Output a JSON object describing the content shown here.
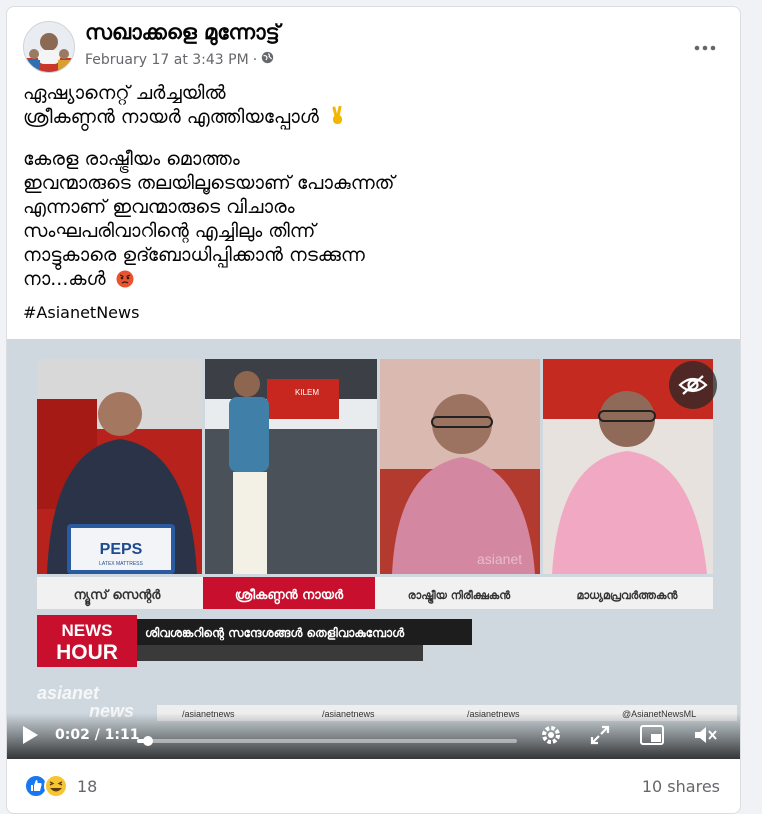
{
  "post": {
    "page_name": "സഖാക്കളെ മുന്നോട്ട്",
    "timestamp": "February 17 at 3:43 PM",
    "separator": "·",
    "body_p1": [
      "ഏഷ്യാനെറ്റ് ചർച്ചയിൽ",
      "ശ്രീകണ്ഠൻ നായർ എത്തിയപ്പോൾ"
    ],
    "body_p2": [
      "കേരള രാഷ്ട്രീയം മൊത്തം",
      "ഇവന്മാരുടെ തലയിലൂടെയാണ് പോകുന്നത്",
      "എന്നാണ് ഇവന്മാരുടെ വിചാരം",
      "സംഘപരിവാറിന്റെ എച്ചിലും തിന്ന്",
      "നാട്ടുകാരെ ഉദ്ബോധിപ്പിക്കാൻ നടക്കുന്ന",
      "നാ...കൾ"
    ],
    "hashtag": "#AsianetNews",
    "emoji_victory": "victory-hand-emoji",
    "emoji_angry": "angry-face-emoji"
  },
  "video": {
    "current_time": "0:02",
    "duration": "1:11",
    "time_display": "0:02 / 1:11",
    "progress_fraction": 0.028,
    "tv": {
      "peps_brand": "PEPS",
      "peps_sub": "LATEX MATTRESS",
      "studio_screen_text": "KILEM",
      "caption_1": "ന്യൂസ് സെന്റർ",
      "caption_2": "ശ്രീകണ്ഠൻ നായർ",
      "caption_3": "രാഷ്ട്രീയ നിരീക്ഷകൻ",
      "caption_4": "മാധ്യമപ്രവർത്തകൻ",
      "show_news": "NEWS",
      "show_hour": "HOUR",
      "headline": "ശിവശങ്കറിന്റെ സന്ദേശങ്ങൾ തെളിവാകുമ്പോൾ",
      "channel_logo_1": "asianet",
      "channel_logo_2": "news",
      "watermark": "asianet",
      "social_1": "/asianetnews",
      "social_2": "/asianetnews",
      "social_3": "/asianetnews",
      "social_4": "@AsianetNewsML"
    }
  },
  "footer": {
    "reaction_count": "18",
    "shares": "10 shares"
  },
  "colors": {
    "fb_blue": "#1877f2",
    "text_secondary": "#65676b",
    "tv_red": "#c8102e"
  }
}
